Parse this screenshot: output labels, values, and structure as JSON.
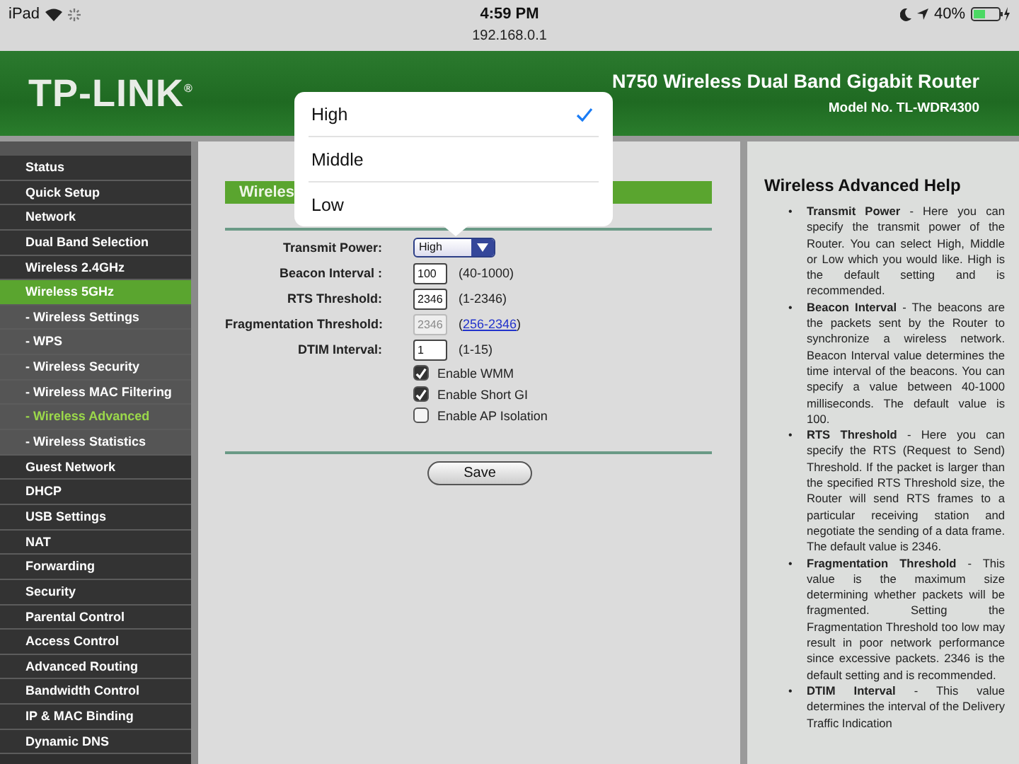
{
  "status_bar": {
    "device": "iPad",
    "time": "4:59 PM",
    "battery_percent": "40%",
    "url": "192.168.0.1"
  },
  "header": {
    "logo": "TP-LINK$^{®}$",
    "product": "N750 Wireless Dual Band Gigabit Router",
    "model": "Model No. TL-WDR4300"
  },
  "sidebar": {
    "items": [
      {
        "label": "Status",
        "selected": false
      },
      {
        "label": "Quick Setup",
        "selected": false
      },
      {
        "label": "Network",
        "selected": false
      },
      {
        "label": "Dual Band Selection",
        "selected": false
      },
      {
        "label": "Wireless 2.4GHz",
        "selected": false
      },
      {
        "label": "Wireless 5GHz",
        "selected": true,
        "expanded": true,
        "children": [
          {
            "label": "- Wireless Settings",
            "selected": false
          },
          {
            "label": "- WPS",
            "selected": false
          },
          {
            "label": "- Wireless Security",
            "selected": false
          },
          {
            "label": "- Wireless MAC Filtering",
            "selected": false
          },
          {
            "label": "- Wireless Advanced",
            "selected": true
          },
          {
            "label": "- Wireless Statistics",
            "selected": false
          }
        ]
      },
      {
        "label": "Guest Network",
        "selected": false
      },
      {
        "label": "DHCP",
        "selected": false
      },
      {
        "label": "USB Settings",
        "selected": false
      },
      {
        "label": "NAT",
        "selected": false
      },
      {
        "label": "Forwarding",
        "selected": false
      },
      {
        "label": "Security",
        "selected": false
      },
      {
        "label": "Parental Control",
        "selected": false
      },
      {
        "label": "Access Control",
        "selected": false
      },
      {
        "label": "Advanced Routing",
        "selected": false
      },
      {
        "label": "Bandwidth Control",
        "selected": false
      },
      {
        "label": "IP & MAC Binding",
        "selected": false
      },
      {
        "label": "Dynamic DNS",
        "selected": false
      }
    ]
  },
  "form": {
    "title": "Wireles",
    "fields": [
      {
        "kind": "select",
        "label": "Transmit Power:",
        "value": "High"
      },
      {
        "kind": "input",
        "label": "Beacon Interval :",
        "value": "100",
        "range": "(40-1000)",
        "disabled": false
      },
      {
        "kind": "input",
        "label": "RTS Threshold:",
        "value": "2346",
        "range": "(1-2346)",
        "disabled": false
      },
      {
        "kind": "input",
        "label": "Fragmentation Threshold:",
        "value": "2346",
        "range_open": "(",
        "range_link": "256-2346",
        "range_close": ")",
        "disabled": true
      },
      {
        "kind": "input",
        "label": "DTIM Interval:",
        "value": "1",
        "range": "(1-15)",
        "disabled": false
      }
    ],
    "checkboxes": [
      {
        "label": "Enable WMM",
        "checked": true
      },
      {
        "label": "Enable Short GI",
        "checked": true
      },
      {
        "label": "Enable AP Isolation",
        "checked": false
      }
    ],
    "save_button": "Save"
  },
  "popover": {
    "options": [
      {
        "label": "High",
        "selected": true
      },
      {
        "label": "Middle",
        "selected": false
      },
      {
        "label": "Low",
        "selected": false
      }
    ]
  },
  "help": {
    "title": "Wireless Advanced Help",
    "bullet": "•",
    "items": [
      "**Transmit Power** - Here you can specify the transmit power of the Router. You can select High, Middle or Low which you would like. High is the default setting and is recommended.",
      "**Beacon Interval** - The beacons are the packets sent by the Router to synchronize a wireless network. Beacon Interval value determines the time interval of the beacons. You can specify a value between 40-1000 milliseconds. The default value is 100.",
      "**RTS Threshold** - Here you can specify the RTS (Request to Send) Threshold. If the packet is larger than the specified RTS Threshold size, the Router will send RTS frames to a particular receiving station and negotiate the sending of a data frame. The default value is 2346.",
      "**Fragmentation Threshold** - This value is the maximum size determining whether packets will be fragmented. Setting the Fragmentation Threshold too low may result in poor network performance since excessive packets. 2346 is the default setting and is recommended.",
      "**DTIM Interval** - This value determines the interval of the Delivery Traffic Indication"
    ]
  }
}
